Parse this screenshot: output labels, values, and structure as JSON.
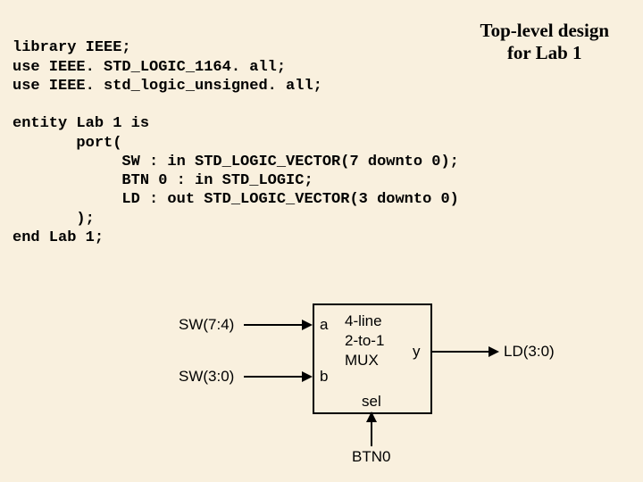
{
  "title_line1": "Top-level design",
  "title_line2": "for Lab 1",
  "code": {
    "l1": "library IEEE;",
    "l2": "use IEEE. STD_LOGIC_1164. all;",
    "l3": "use IEEE. std_logic_unsigned. all;",
    "l4": "",
    "l5": "entity Lab 1 is",
    "l6": "       port(",
    "l7": "            SW : in STD_LOGIC_VECTOR(7 downto 0);",
    "l8": "            BTN 0 : in STD_LOGIC;",
    "l9": "            LD : out STD_LOGIC_VECTOR(3 downto 0)",
    "l10": "       );",
    "l11": "end Lab 1;"
  },
  "diagram": {
    "in_top": "SW(7:4)",
    "in_bot": "SW(3:0)",
    "port_a": "a",
    "port_b": "b",
    "port_sel": "sel",
    "port_y": "y",
    "mux_l1": "4-line",
    "mux_l2": "2-to-1",
    "mux_l3": "MUX",
    "out": "LD(3:0)",
    "sel_in": "BTN0"
  }
}
